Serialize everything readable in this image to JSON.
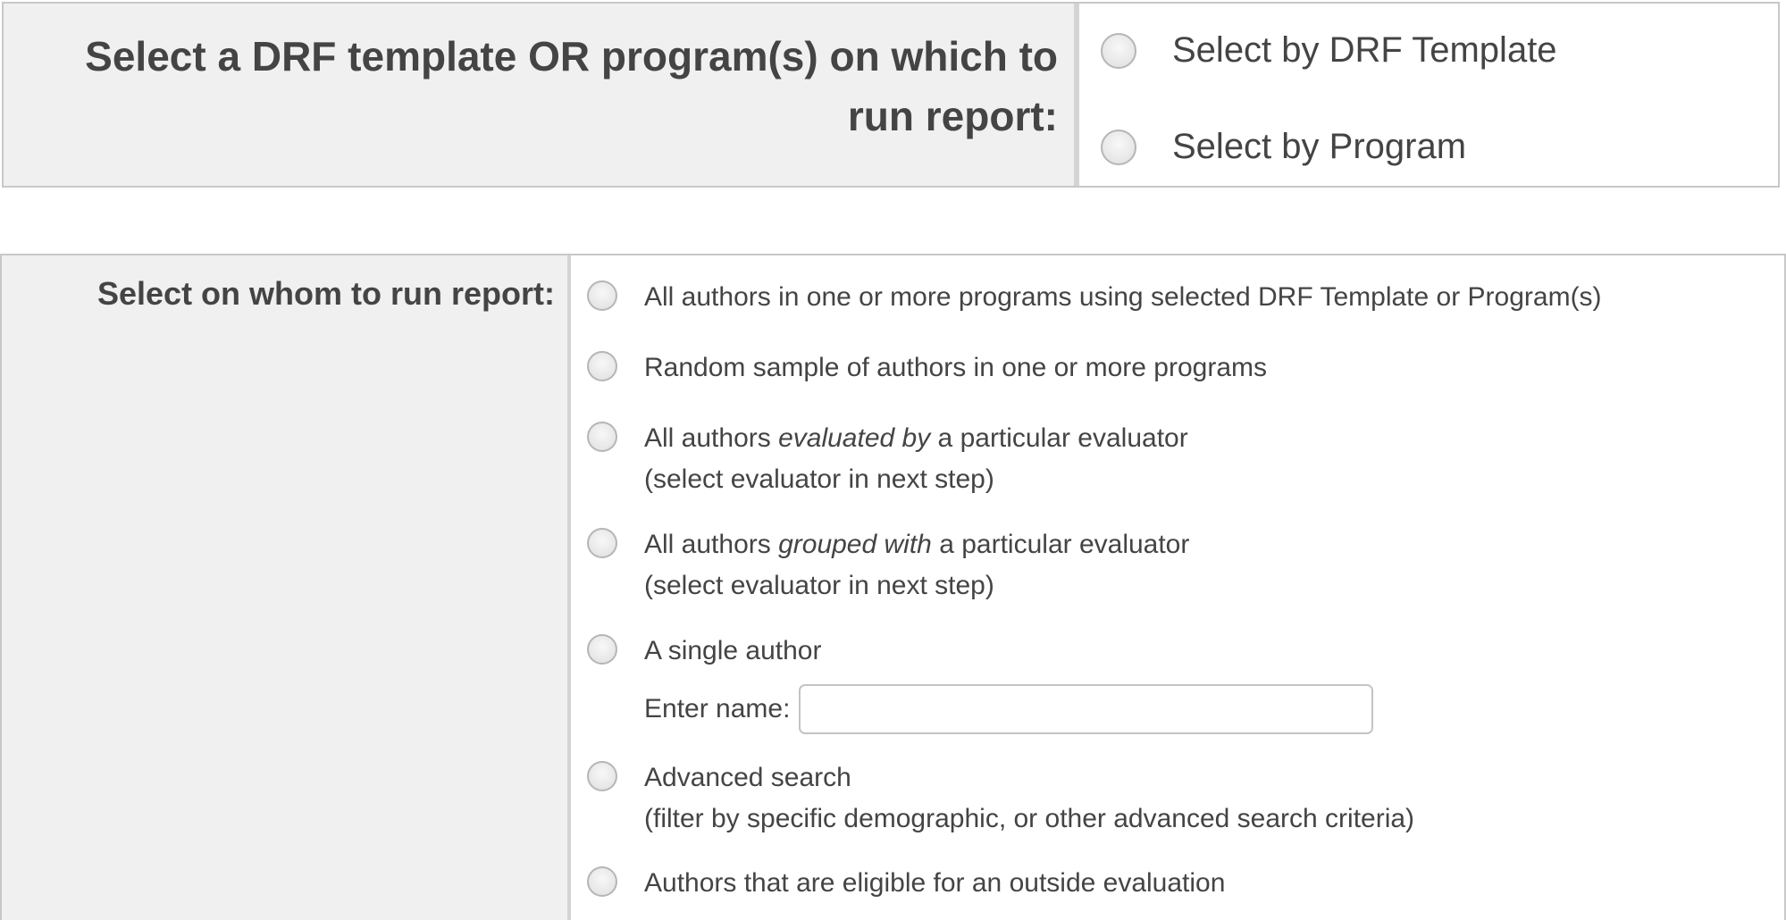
{
  "source_selection": {
    "label": "Select a DRF template OR program(s) on which to run report:",
    "options": [
      {
        "label": "Select by DRF Template",
        "selected": false
      },
      {
        "label": "Select by Program",
        "selected": false
      }
    ]
  },
  "target_selection": {
    "label": "Select on whom to run report:",
    "options": {
      "all_authors": {
        "line1": "All authors in one or more programs using selected DRF Template or Program(s)"
      },
      "random_sample": {
        "line1": "Random sample of authors in one or more programs"
      },
      "evaluated_by": {
        "prefix": "All authors ",
        "emphasis": "evaluated by",
        "suffix": " a particular evaluator",
        "line2": "(select evaluator in next step)"
      },
      "grouped_with": {
        "prefix": "All authors ",
        "emphasis": "grouped with",
        "suffix": " a particular evaluator",
        "line2": "(select evaluator in next step)"
      },
      "single_author": {
        "line1": "A single author",
        "name_label": "Enter name:",
        "name_value": "",
        "name_placeholder": ""
      },
      "advanced_search": {
        "line1": "Advanced search",
        "line2": "(filter by specific demographic, or other advanced search criteria)"
      },
      "outside_evaluation": {
        "line1": "Authors that are eligible for an outside evaluation"
      }
    }
  }
}
